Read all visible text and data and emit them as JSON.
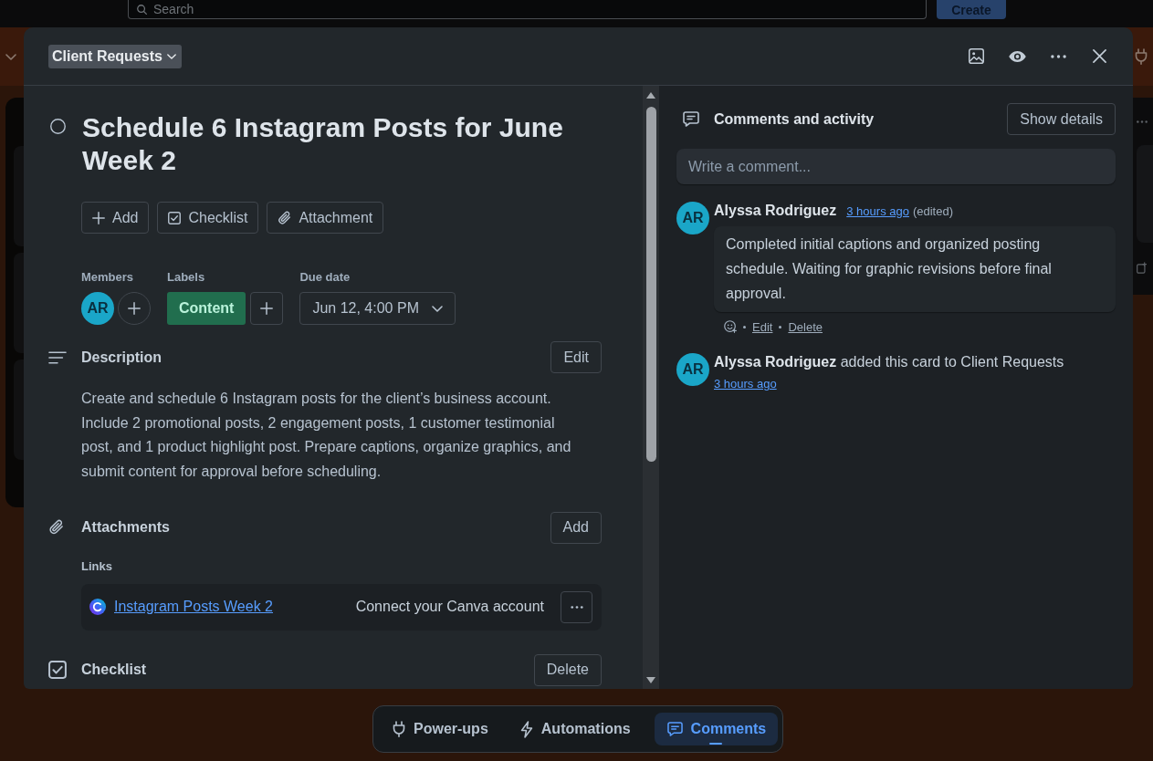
{
  "top_bar": {
    "search": {
      "placeholder": "Search"
    },
    "create_button": "Create"
  },
  "card": {
    "list_button": "Client Requests",
    "completed": false,
    "title": "Schedule 6 Instagram Posts for June Week 2",
    "actions": [
      {
        "kind": "add",
        "label": "Add"
      },
      {
        "kind": "checklist",
        "label": "Checklist"
      },
      {
        "kind": "attachment",
        "label": "Attachment"
      }
    ],
    "members": {
      "label": "Members",
      "avatars": [
        {
          "initials": "AR"
        }
      ]
    },
    "labels": {
      "label": "Labels",
      "items": [
        {
          "text": "Content",
          "color": "#216e4e"
        }
      ]
    },
    "due_date": {
      "label": "Due date",
      "value": "Jun 12, 4:00 PM"
    },
    "description": {
      "heading": "Description",
      "edit_button": "Edit",
      "text": "Create and schedule 6 Instagram posts for the client’s business account. Include 2 promotional posts, 2 engagement posts, 1 customer testimonial post, and 1 product highlight post. Prepare captions, organize graphics, and submit content for approval before scheduling."
    },
    "attachments": {
      "heading": "Attachments",
      "add_button": "Add",
      "links_heading": "Links",
      "links": [
        {
          "title": "Instagram Posts Week 2",
          "action": "Connect your Canva account"
        }
      ]
    },
    "checklist": {
      "heading": "Checklist",
      "delete_button": "Delete"
    }
  },
  "activity": {
    "heading": "Comments and activity",
    "show_details_button": "Show details",
    "comment_field": {
      "placeholder": "Write a comment..."
    },
    "entries": [
      {
        "kind": "comment",
        "initials": "AR",
        "author": "Alyssa Rodriguez",
        "time": "3 hours ago",
        "edited": "(edited)",
        "text": "Completed initial captions and organized posting schedule. Waiting for graphic revisions before final approval.",
        "actions": [
          "Edit",
          "Delete"
        ]
      },
      {
        "kind": "event",
        "initials": "AR",
        "text": "**Alyssa Rodriguez** added this card to Client Requests",
        "time": "3 hours ago"
      }
    ]
  },
  "bottom_bar": {
    "items": [
      {
        "kind": "power-ups",
        "label": "Power-ups",
        "selected": false
      },
      {
        "kind": "automations",
        "label": "Automations",
        "selected": false
      },
      {
        "kind": "comments",
        "label": "Comments",
        "selected": true
      }
    ]
  }
}
